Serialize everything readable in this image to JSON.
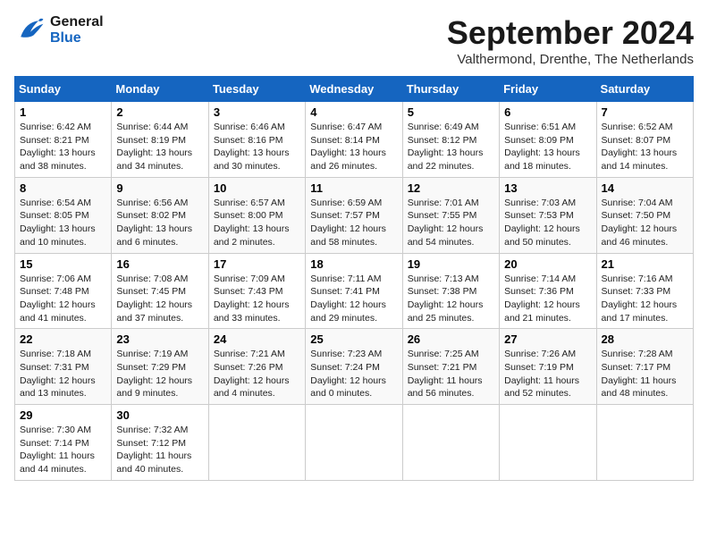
{
  "logo": {
    "line1": "General",
    "line2": "Blue"
  },
  "title": "September 2024",
  "subtitle": "Valthermond, Drenthe, The Netherlands",
  "headers": [
    "Sunday",
    "Monday",
    "Tuesday",
    "Wednesday",
    "Thursday",
    "Friday",
    "Saturday"
  ],
  "weeks": [
    [
      {
        "day": "1",
        "info": "Sunrise: 6:42 AM\nSunset: 8:21 PM\nDaylight: 13 hours\nand 38 minutes."
      },
      {
        "day": "2",
        "info": "Sunrise: 6:44 AM\nSunset: 8:19 PM\nDaylight: 13 hours\nand 34 minutes."
      },
      {
        "day": "3",
        "info": "Sunrise: 6:46 AM\nSunset: 8:16 PM\nDaylight: 13 hours\nand 30 minutes."
      },
      {
        "day": "4",
        "info": "Sunrise: 6:47 AM\nSunset: 8:14 PM\nDaylight: 13 hours\nand 26 minutes."
      },
      {
        "day": "5",
        "info": "Sunrise: 6:49 AM\nSunset: 8:12 PM\nDaylight: 13 hours\nand 22 minutes."
      },
      {
        "day": "6",
        "info": "Sunrise: 6:51 AM\nSunset: 8:09 PM\nDaylight: 13 hours\nand 18 minutes."
      },
      {
        "day": "7",
        "info": "Sunrise: 6:52 AM\nSunset: 8:07 PM\nDaylight: 13 hours\nand 14 minutes."
      }
    ],
    [
      {
        "day": "8",
        "info": "Sunrise: 6:54 AM\nSunset: 8:05 PM\nDaylight: 13 hours\nand 10 minutes."
      },
      {
        "day": "9",
        "info": "Sunrise: 6:56 AM\nSunset: 8:02 PM\nDaylight: 13 hours\nand 6 minutes."
      },
      {
        "day": "10",
        "info": "Sunrise: 6:57 AM\nSunset: 8:00 PM\nDaylight: 13 hours\nand 2 minutes."
      },
      {
        "day": "11",
        "info": "Sunrise: 6:59 AM\nSunset: 7:57 PM\nDaylight: 12 hours\nand 58 minutes."
      },
      {
        "day": "12",
        "info": "Sunrise: 7:01 AM\nSunset: 7:55 PM\nDaylight: 12 hours\nand 54 minutes."
      },
      {
        "day": "13",
        "info": "Sunrise: 7:03 AM\nSunset: 7:53 PM\nDaylight: 12 hours\nand 50 minutes."
      },
      {
        "day": "14",
        "info": "Sunrise: 7:04 AM\nSunset: 7:50 PM\nDaylight: 12 hours\nand 46 minutes."
      }
    ],
    [
      {
        "day": "15",
        "info": "Sunrise: 7:06 AM\nSunset: 7:48 PM\nDaylight: 12 hours\nand 41 minutes."
      },
      {
        "day": "16",
        "info": "Sunrise: 7:08 AM\nSunset: 7:45 PM\nDaylight: 12 hours\nand 37 minutes."
      },
      {
        "day": "17",
        "info": "Sunrise: 7:09 AM\nSunset: 7:43 PM\nDaylight: 12 hours\nand 33 minutes."
      },
      {
        "day": "18",
        "info": "Sunrise: 7:11 AM\nSunset: 7:41 PM\nDaylight: 12 hours\nand 29 minutes."
      },
      {
        "day": "19",
        "info": "Sunrise: 7:13 AM\nSunset: 7:38 PM\nDaylight: 12 hours\nand 25 minutes."
      },
      {
        "day": "20",
        "info": "Sunrise: 7:14 AM\nSunset: 7:36 PM\nDaylight: 12 hours\nand 21 minutes."
      },
      {
        "day": "21",
        "info": "Sunrise: 7:16 AM\nSunset: 7:33 PM\nDaylight: 12 hours\nand 17 minutes."
      }
    ],
    [
      {
        "day": "22",
        "info": "Sunrise: 7:18 AM\nSunset: 7:31 PM\nDaylight: 12 hours\nand 13 minutes."
      },
      {
        "day": "23",
        "info": "Sunrise: 7:19 AM\nSunset: 7:29 PM\nDaylight: 12 hours\nand 9 minutes."
      },
      {
        "day": "24",
        "info": "Sunrise: 7:21 AM\nSunset: 7:26 PM\nDaylight: 12 hours\nand 4 minutes."
      },
      {
        "day": "25",
        "info": "Sunrise: 7:23 AM\nSunset: 7:24 PM\nDaylight: 12 hours\nand 0 minutes."
      },
      {
        "day": "26",
        "info": "Sunrise: 7:25 AM\nSunset: 7:21 PM\nDaylight: 11 hours\nand 56 minutes."
      },
      {
        "day": "27",
        "info": "Sunrise: 7:26 AM\nSunset: 7:19 PM\nDaylight: 11 hours\nand 52 minutes."
      },
      {
        "day": "28",
        "info": "Sunrise: 7:28 AM\nSunset: 7:17 PM\nDaylight: 11 hours\nand 48 minutes."
      }
    ],
    [
      {
        "day": "29",
        "info": "Sunrise: 7:30 AM\nSunset: 7:14 PM\nDaylight: 11 hours\nand 44 minutes."
      },
      {
        "day": "30",
        "info": "Sunrise: 7:32 AM\nSunset: 7:12 PM\nDaylight: 11 hours\nand 40 minutes."
      },
      {
        "day": "",
        "info": ""
      },
      {
        "day": "",
        "info": ""
      },
      {
        "day": "",
        "info": ""
      },
      {
        "day": "",
        "info": ""
      },
      {
        "day": "",
        "info": ""
      }
    ]
  ]
}
